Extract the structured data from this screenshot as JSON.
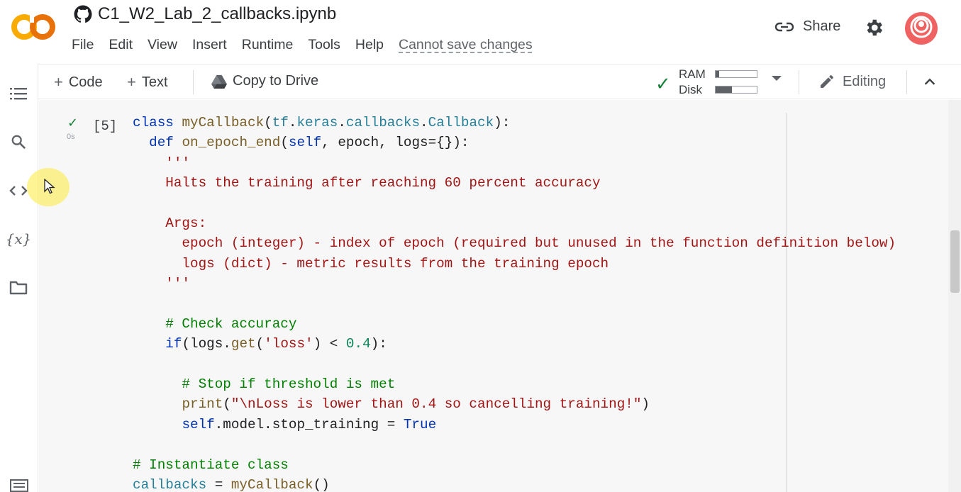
{
  "colors": {
    "logo_orange": "#f9ab00",
    "logo_dark_orange": "#e8710a",
    "run_check_green": "#188038",
    "avatar_red": "#f06262"
  },
  "header": {
    "title": "C1_W2_Lab_2_callbacks.ipynb",
    "title_icon": "github-icon",
    "menu": [
      "File",
      "Edit",
      "View",
      "Insert",
      "Runtime",
      "Tools",
      "Help"
    ],
    "save_status": "Cannot save changes",
    "share_label": "Share",
    "share_icon": "link-icon",
    "settings_icon": "gear-icon",
    "avatar_icon": "avatar"
  },
  "toolbar": {
    "add_code": "Code",
    "add_text": "Text",
    "copy_to_drive": "Copy to Drive",
    "ram_label": "RAM",
    "disk_label": "Disk",
    "ram_usage": 0.08,
    "disk_usage": 0.4,
    "editing_label": "Editing"
  },
  "sidebar": {
    "icons": [
      "toc-icon",
      "search-icon",
      "code-snippets-icon",
      "variables-icon",
      "folder-icon",
      "terminal-icon"
    ],
    "variables_text": "{x}"
  },
  "cell": {
    "execution_count": "[5]",
    "run_time": "0s",
    "code_lines": [
      "class myCallback(tf.keras.callbacks.Callback):",
      "  def on_epoch_end(self, epoch, logs={}):",
      "    '''",
      "    Halts the training after reaching 60 percent accuracy",
      "",
      "    Args:",
      "      epoch (integer) - index of epoch (required but unused in the function definition below)",
      "      logs (dict) - metric results from the training epoch",
      "    '''",
      "",
      "    # Check accuracy",
      "    if(logs.get('loss') < 0.4):",
      "",
      "      # Stop if threshold is met",
      "      print(\"\\nLoss is lower than 0.4 so cancelling training!\")",
      "      self.model.stop_training = True",
      "",
      "# Instantiate class",
      "callbacks = myCallback()"
    ]
  }
}
